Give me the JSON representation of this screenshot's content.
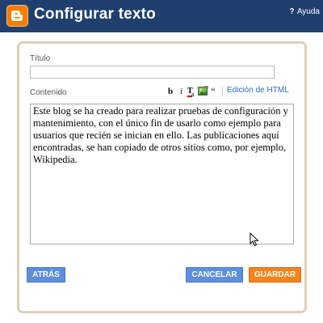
{
  "header": {
    "title": "Configurar texto",
    "help_icon": "?",
    "help_label": "Ayuda"
  },
  "form": {
    "title_label": "Título",
    "title_value": "",
    "content_label": "Contenido",
    "toolbar": {
      "bold": "b",
      "italic": "i",
      "html_link": "Edición de HTML"
    },
    "content_text": "Este blog se ha creado para realizar pruebas de configuración y mantenimiento, con el único fin de usarlo como ejemplo para usuarios que recién se inician en ello. Las publicaciones aquí encontradas, se han copiado de otros sitios como, por ejemplo, Wikipedia."
  },
  "buttons": {
    "back": "ATRÁS",
    "cancel": "CANCELAR",
    "save": "GUARDAR"
  },
  "colors": {
    "header_bg": "#1f3f6e",
    "logo": "#f57d00",
    "panel_border": "#dcd2b8",
    "blue_button": "#5e8ede",
    "save_button": "#f2831e",
    "link": "#3366cc"
  }
}
